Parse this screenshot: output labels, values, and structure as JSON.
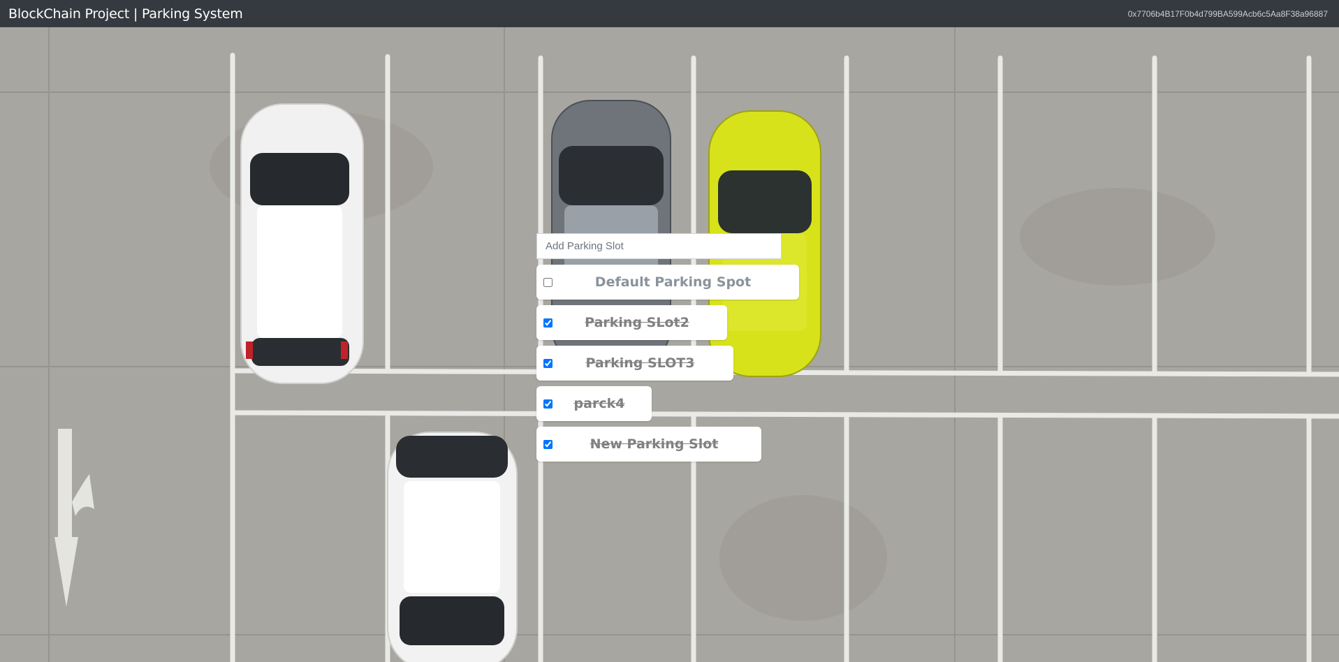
{
  "navbar": {
    "title": "BlockChain Project | Parking System",
    "account": "0x7706b4B17F0b4d799BA599Acb6c5Aa8F38a96887"
  },
  "background": {
    "description_icon": "parking-lot-aerial-image",
    "asphalt_color": "#a8a6a0",
    "line_color": "#e9e9e6"
  },
  "form": {
    "placeholder": "Add Parking Slot",
    "value": ""
  },
  "slots": [
    {
      "label": "Default Parking Spot",
      "checked": false
    },
    {
      "label": "Parking SLot2",
      "checked": true
    },
    {
      "label": "Parking SLOT3",
      "checked": true
    },
    {
      "label": "parck4",
      "checked": true
    },
    {
      "label": "New Parking Slot",
      "checked": true
    }
  ]
}
